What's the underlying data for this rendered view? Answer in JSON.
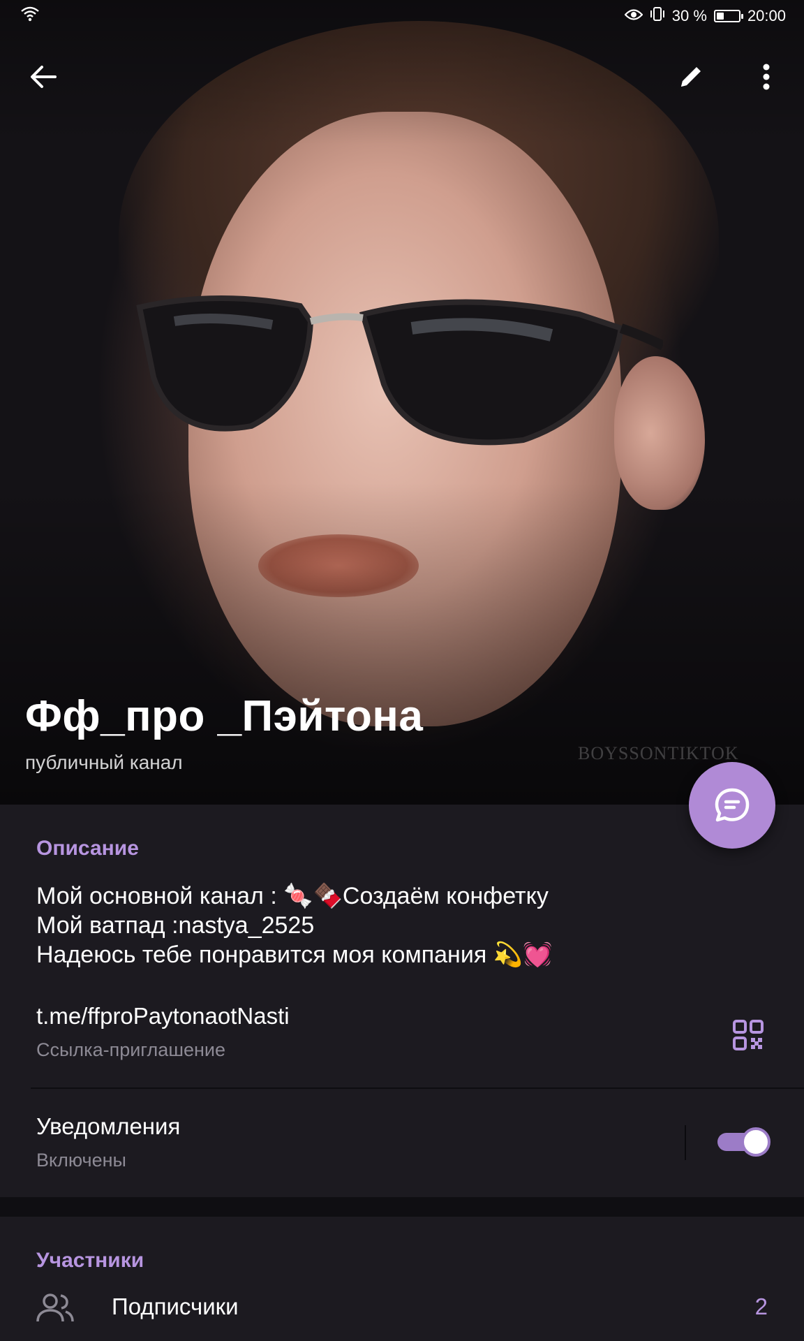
{
  "status_bar": {
    "battery_percent": "30 %",
    "battery_level": 0.3,
    "time": "20:00"
  },
  "toolbar": {
    "back_icon": "arrow-left-icon",
    "edit_icon": "pencil-icon",
    "more_icon": "more-vertical-icon"
  },
  "channel": {
    "name": "Фф_про _Пэйтона",
    "type": "публичный канал",
    "photo_watermark": "BOYSSONTIKTOK"
  },
  "fab": {
    "icon": "chat-bubble-icon"
  },
  "info": {
    "description_title": "Описание",
    "description_lines": [
      "Мой основной канал : 🍬🍫Создаём конфетку",
      "Мой ватпад :nastya_2525",
      "Надеюсь тебе понравится моя компания 💫💓"
    ],
    "link": "t.me/ffproPaytonaotNasti",
    "link_caption": "Ссылка-приглашение",
    "notifications_title": "Уведомления",
    "notifications_state": "Включены",
    "notifications_enabled": true
  },
  "members": {
    "section_title": "Участники",
    "subscribers_label": "Подписчики",
    "subscribers_count": "2"
  },
  "colors": {
    "accent": "#b795e0",
    "fab": "#b08ad6",
    "card_bg": "#1c1a20",
    "page_bg": "#0f0e12"
  }
}
